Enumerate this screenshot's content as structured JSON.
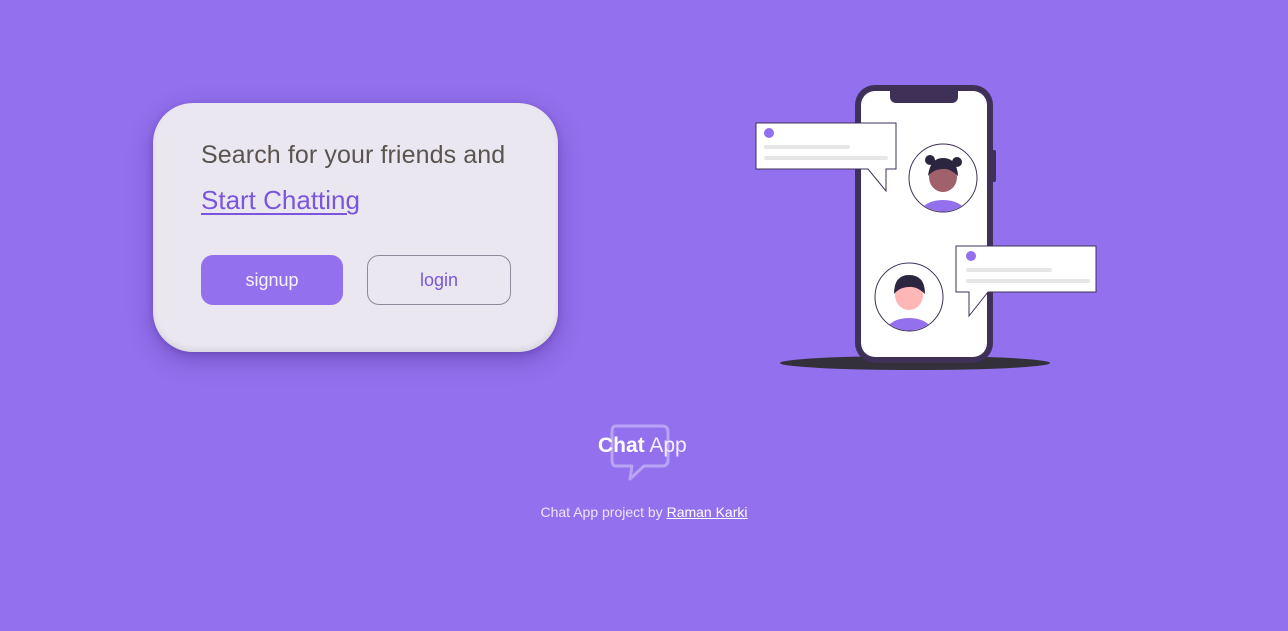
{
  "hero": {
    "headline": "Search for your friends and",
    "cta_link": "Start Chatting",
    "signup_label": "signup",
    "login_label": "login"
  },
  "illustration": {
    "accent_color": "#9370ed",
    "phone_color": "#3f3058"
  },
  "logo": {
    "bold_text": "Chat",
    "light_text": "App"
  },
  "footer": {
    "prefix": "Chat App project by",
    "author": "Raman Karki"
  },
  "colors": {
    "background": "#9370ed",
    "card": "#ebe7f0",
    "accent": "#7a55dd"
  }
}
